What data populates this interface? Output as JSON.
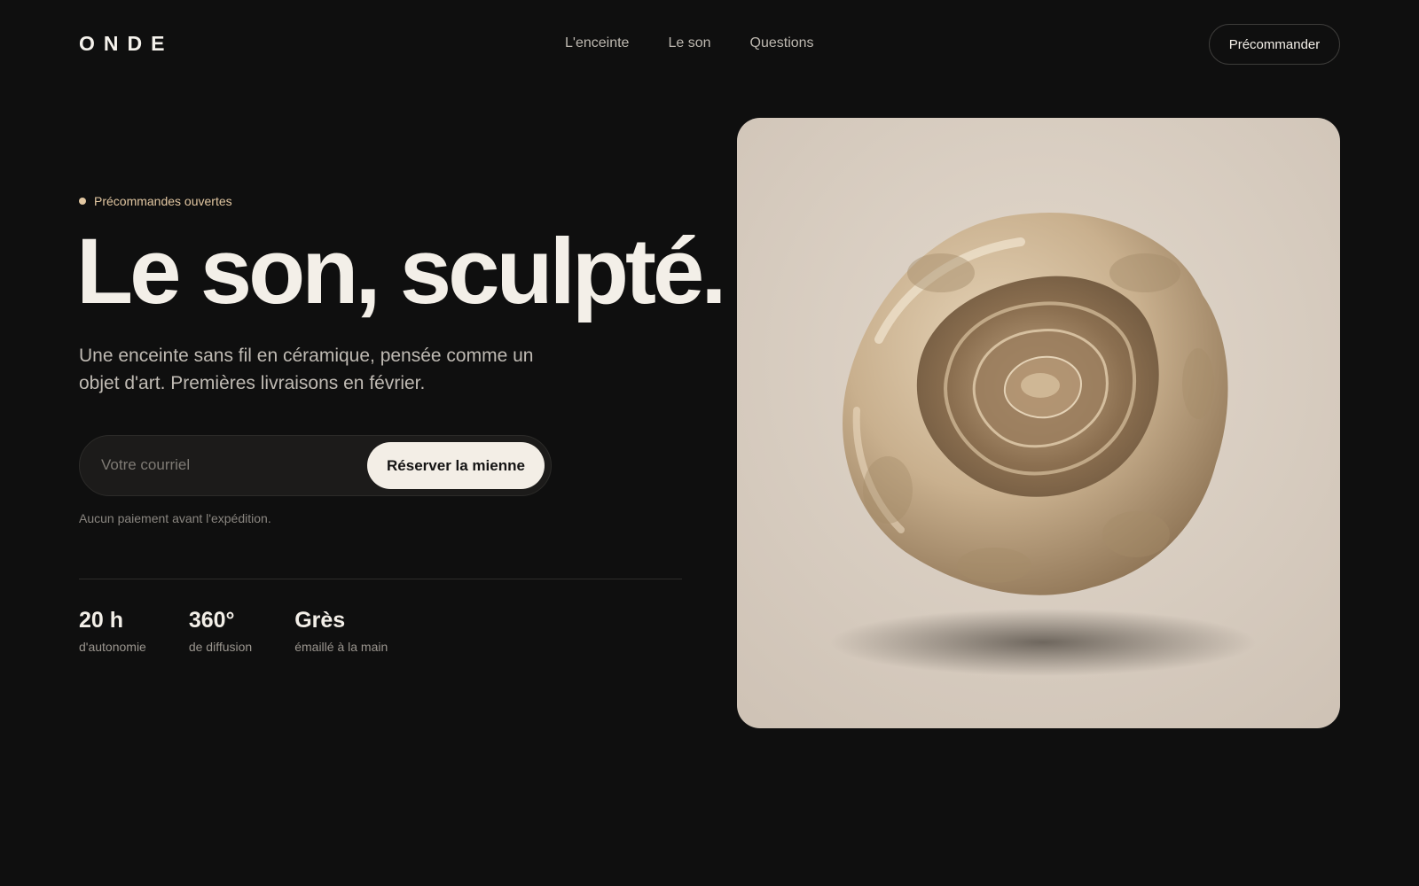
{
  "brand": {
    "logo": "ONDE"
  },
  "nav": {
    "items": [
      {
        "label": "L'enceinte"
      },
      {
        "label": "Le son"
      },
      {
        "label": "Questions"
      }
    ],
    "cta_label": "Précommander"
  },
  "hero": {
    "eyebrow": "Précommandes ouvertes",
    "headline": "Le son, sculpté.",
    "lede": "Une enceinte sans fil en céramique, pensée comme un objet d'art. Premières livraisons en février.",
    "form": {
      "email_placeholder": "Votre courriel",
      "email_value": "",
      "submit_label": "Réserver la mienne"
    },
    "note": "Aucun paiement avant l'expédition.",
    "stats": [
      {
        "value": "20 h",
        "label": "d'autonomie"
      },
      {
        "value": "360°",
        "label": "de diffusion"
      },
      {
        "value": "Grès",
        "label": "émaillé à la main"
      }
    ],
    "image": {
      "subject": "ceramic-speaker-image"
    }
  },
  "colors": {
    "background": "#0f0f0f",
    "text": "#f3efe8",
    "accent": "#e2c7a2",
    "muted": "#bfbab3",
    "image_backdrop": "#ddd3c7"
  }
}
